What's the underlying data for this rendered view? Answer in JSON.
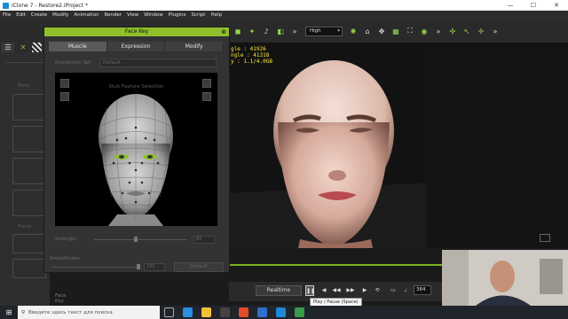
{
  "window": {
    "title": "iClone 7 - Restore2.iProject *",
    "controls": [
      "—",
      "☐",
      "✕"
    ]
  },
  "menu": [
    "File",
    "Edit",
    "Create",
    "Modify",
    "Animation",
    "Render",
    "View",
    "Window",
    "Plugins",
    "Script",
    "Help"
  ],
  "toolbar": {
    "quality": "High",
    "more": "»"
  },
  "stats": {
    "line1": "gle : 41926",
    "line2": "ngle : 41318",
    "line3": "y : 1.1/4.0GB"
  },
  "face_key": {
    "title": "Face Key",
    "close": "⊗",
    "tabs": [
      "Muscle",
      "Expression",
      "Modify"
    ],
    "active_tab": "Muscle",
    "expression_set_label": "Expression Set",
    "expression_set_value": "Default",
    "canvas_label": "Stub Feature Selection",
    "strength_label": "Strength",
    "strength_value": "60",
    "reset_value": "100",
    "smoothness_label": "Smoothness",
    "smoothness_value": "100",
    "action_button": "Default"
  },
  "left_panel": {
    "labels": [
      "Body",
      "Facial",
      "Face Key"
    ]
  },
  "timeline": {
    "realtime_label": "Realtime",
    "play_pause_glyph": "❚❚",
    "frame": "384",
    "tooltip": "Play / Pause (Space)"
  },
  "taskbar": {
    "search_placeholder": "Введите здесь текст для поиска"
  },
  "colors": {
    "accent_green": "#8fbf2b",
    "stats_yellow": "#ffea3a"
  }
}
